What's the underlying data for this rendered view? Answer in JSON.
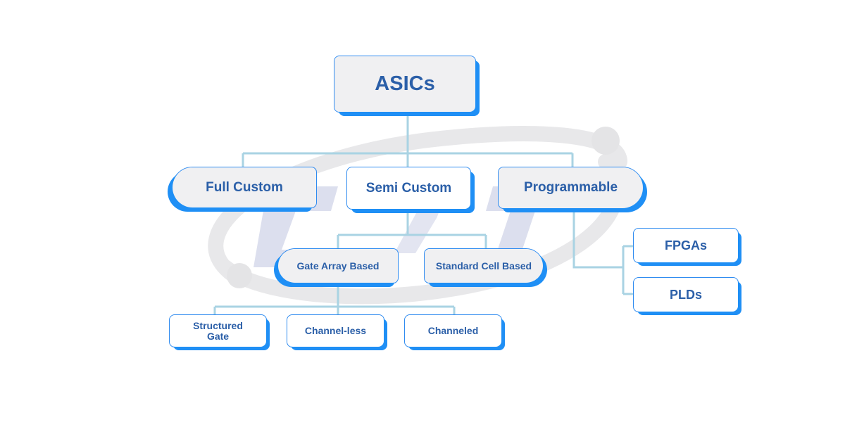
{
  "colors": {
    "border": "#2f8bf0",
    "shadow": "#1f8ff5",
    "text": "#2b5fa8",
    "connector": "#a9d3e3",
    "grey_fill": "#f0f0f2",
    "watermark_swoosh": "#e6e6e8",
    "watermark_letters": "#d9ddec"
  },
  "diagram": {
    "root": {
      "label": "ASICs"
    },
    "level1": [
      {
        "label": "Full Custom"
      },
      {
        "label": "Semi Custom"
      },
      {
        "label": "Programmable"
      }
    ],
    "semi_custom_children": [
      {
        "label": "Gate Array Based"
      },
      {
        "label": "Standard Cell Based"
      }
    ],
    "gate_array_children": [
      {
        "label": "Structured Gate"
      },
      {
        "label": "Channel-less"
      },
      {
        "label": "Channeled"
      }
    ],
    "programmable_children": [
      {
        "label": "FPGAs"
      },
      {
        "label": "PLDs"
      }
    ]
  }
}
